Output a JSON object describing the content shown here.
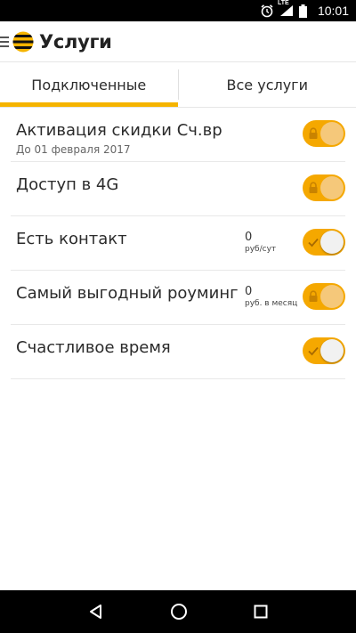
{
  "status_bar": {
    "network_label": "LTE",
    "time": "10:01"
  },
  "app_bar": {
    "title": "Услуги",
    "icons": [
      "menu-icon",
      "beeline-logo"
    ]
  },
  "tabs": [
    {
      "label": "Подключенные",
      "active": true
    },
    {
      "label": "Все услуги",
      "active": false
    }
  ],
  "services": [
    {
      "title": "Активация скидки Сч.вр",
      "subtitle": "До 01 февраля 2017",
      "price": "",
      "unit": "",
      "toggle": "locked-on"
    },
    {
      "title": "Доступ в 4G",
      "subtitle": "",
      "price": "",
      "unit": "",
      "toggle": "locked-on"
    },
    {
      "title": "Есть контакт",
      "subtitle": "",
      "price": "0",
      "unit": "руб/сут",
      "toggle": "on"
    },
    {
      "title": "Самый выгодный роуминг",
      "subtitle": "",
      "price": "0",
      "unit": "руб. в месяц",
      "toggle": "locked-on"
    },
    {
      "title": "Счастливое время",
      "subtitle": "",
      "price": "",
      "unit": "",
      "toggle": "on"
    }
  ],
  "colors": {
    "accent": "#f5b400",
    "toggle_on": "#f5a800"
  }
}
